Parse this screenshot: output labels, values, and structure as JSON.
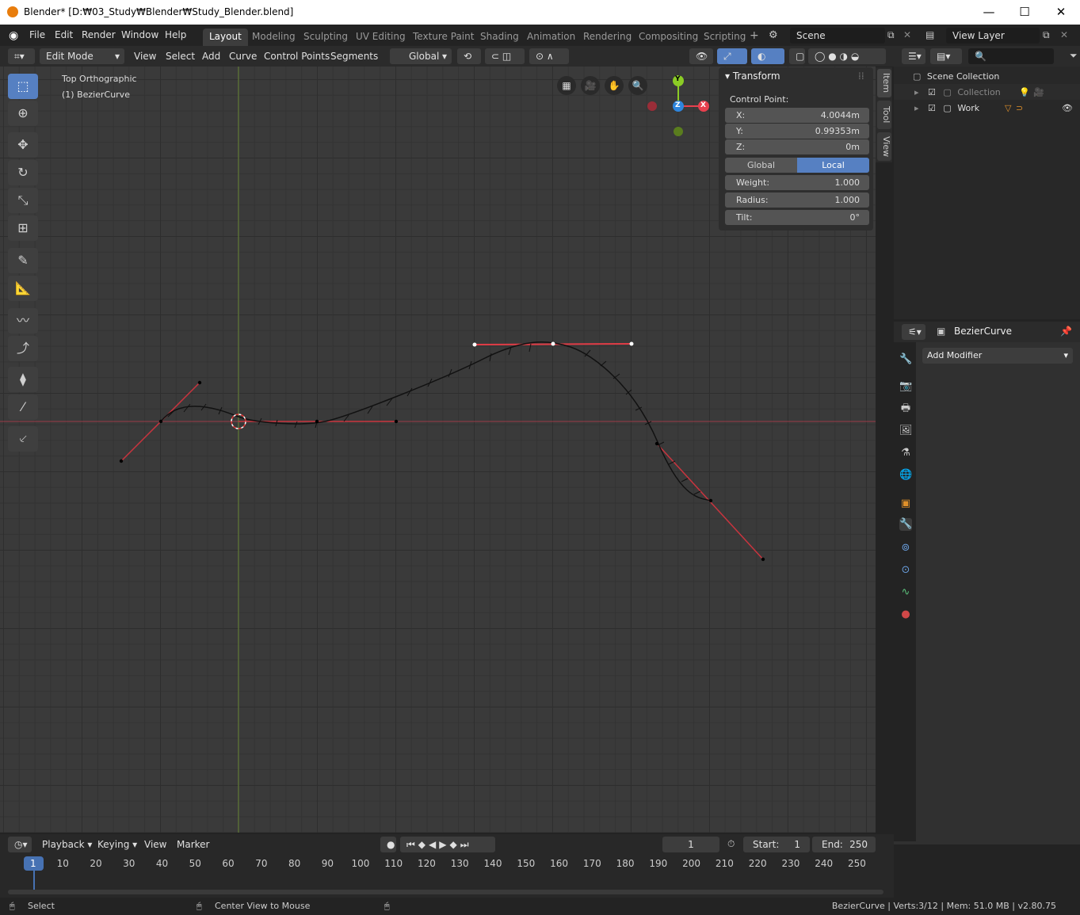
{
  "titlebar": {
    "title": "Blender* [D:₩03_Study₩Blender₩Study_Blender.blend]"
  },
  "menu": [
    "File",
    "Edit",
    "Render",
    "Window",
    "Help"
  ],
  "workspaces": [
    "Layout",
    "Modeling",
    "Sculpting",
    "UV Editing",
    "Texture Paint",
    "Shading",
    "Animation",
    "Rendering",
    "Compositing",
    "Scripting"
  ],
  "scene": {
    "label": "Scene"
  },
  "view_layer": {
    "label": "View Layer"
  },
  "viewport_header": {
    "mode": "Edit Mode",
    "menus": [
      "View",
      "Select",
      "Add",
      "Curve",
      "Control Points",
      "Segments"
    ],
    "orientation": "Global"
  },
  "viewport": {
    "view_name": "Top Orthographic",
    "object_name": "(1) BezierCurve"
  },
  "gizmo": {
    "y": "Y",
    "z": "Z",
    "x": "X"
  },
  "npanel": {
    "header": "Transform",
    "section": "Control Point:",
    "x_label": "X:",
    "x_value": "4.0044m",
    "y_label": "Y:",
    "y_value": "0.99353m",
    "z_label": "Z:",
    "z_value": "0m",
    "global_label": "Global",
    "local_label": "Local",
    "weight_label": "Weight:",
    "weight_value": "1.000",
    "radius_label": "Radius:",
    "radius_value": "1.000",
    "tilt_label": "Tilt:",
    "tilt_value": "0°"
  },
  "sidetabs": {
    "item": "Item",
    "tool": "Tool",
    "view": "View"
  },
  "outliner": {
    "scene_collection": "Scene Collection",
    "collection": "Collection",
    "work": "Work"
  },
  "properties": {
    "object_name": "BezierCurve",
    "add_modifier": "Add Modifier"
  },
  "timeline": {
    "menus": [
      "Playback",
      "Keying",
      "View",
      "Marker"
    ],
    "current_frame": "1",
    "start_label": "Start:",
    "start_value": "1",
    "end_label": "End:",
    "end_value": "250",
    "ruler": [
      "1",
      "10",
      "20",
      "30",
      "40",
      "50",
      "60",
      "70",
      "80",
      "90",
      "100",
      "110",
      "120",
      "130",
      "140",
      "150",
      "160",
      "170",
      "180",
      "190",
      "200",
      "210",
      "220",
      "230",
      "240",
      "250"
    ]
  },
  "statusbar": {
    "select": "Select",
    "center_view": "Center View to Mouse",
    "info": "BezierCurve | Verts:3/12 | Mem: 51.0 MB | v2.80.75"
  },
  "colors": {
    "accent": "#5680c2",
    "handle": "#c9343e",
    "x_axis": "#e8404e",
    "y_axis": "#8bcc25",
    "z_axis": "#2e86de"
  }
}
